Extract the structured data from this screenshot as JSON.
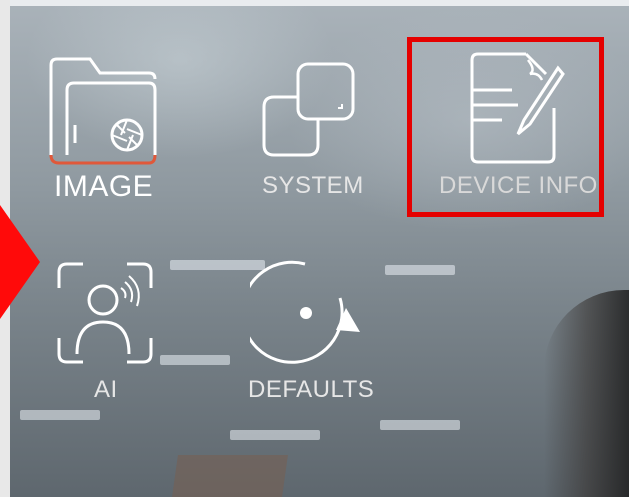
{
  "menu": {
    "items": [
      {
        "label": "IMAGE",
        "icon": "image-folder-icon"
      },
      {
        "label": "SYSTEM",
        "icon": "system-windows-icon"
      },
      {
        "label": "DEVICE INFO",
        "icon": "document-edit-icon"
      },
      {
        "label": "AI",
        "icon": "face-recognition-icon"
      },
      {
        "label": "DEFAULTS",
        "icon": "reset-defaults-icon"
      }
    ]
  },
  "colors": {
    "highlight_border": "#e50000",
    "pointer_arrow": "#ff0a0a",
    "icon_stroke": "#ffffff",
    "image_accent": "#e0583a"
  }
}
